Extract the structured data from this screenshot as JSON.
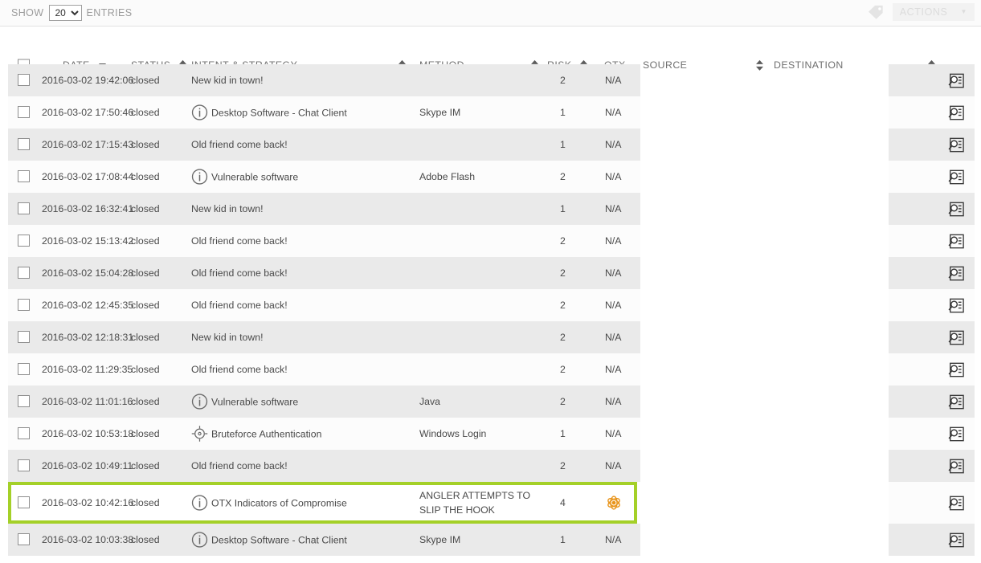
{
  "toolbar": {
    "show_label": "SHOW",
    "entries_label": "ENTRIES",
    "entries_value": "20",
    "entries_options": [
      "20"
    ],
    "tag_icon": "tag-icon",
    "actions_label": "ACTIONS",
    "actions_caret": "▼",
    "actions_disabled": true
  },
  "table": {
    "columns": [
      {
        "label": "DATE",
        "sort": "desc"
      },
      {
        "label": "STATUS",
        "sort": "none"
      },
      {
        "label": "INTENT & STRATEGY",
        "sort": "none"
      },
      {
        "label": "METHOD",
        "sort": "none"
      },
      {
        "label": "RISK",
        "sort": "none"
      },
      {
        "label": "OTX",
        "sort": "hidden"
      },
      {
        "label": "SOURCE",
        "sort": "none"
      },
      {
        "label": "DESTINATION",
        "sort": "none"
      }
    ],
    "rows": [
      {
        "date": "2016-03-02 19:42:06",
        "status": "closed",
        "intent": "New kid in town!",
        "intent_icon": "",
        "method": "",
        "risk": "2",
        "otx": "N/A",
        "highlight": false
      },
      {
        "date": "2016-03-02 17:50:46",
        "status": "closed",
        "intent": "Desktop Software - Chat Client",
        "intent_icon": "info-icon",
        "method": "Skype IM",
        "risk": "1",
        "otx": "N/A",
        "highlight": false
      },
      {
        "date": "2016-03-02 17:15:43",
        "status": "closed",
        "intent": "Old friend come back!",
        "intent_icon": "",
        "method": "",
        "risk": "1",
        "otx": "N/A",
        "highlight": false
      },
      {
        "date": "2016-03-02 17:08:44",
        "status": "closed",
        "intent": "Vulnerable software",
        "intent_icon": "info-icon",
        "method": "Adobe Flash",
        "risk": "2",
        "otx": "N/A",
        "highlight": false
      },
      {
        "date": "2016-03-02 16:32:41",
        "status": "closed",
        "intent": "New kid in town!",
        "intent_icon": "",
        "method": "",
        "risk": "1",
        "otx": "N/A",
        "highlight": false
      },
      {
        "date": "2016-03-02 15:13:42",
        "status": "closed",
        "intent": "Old friend come back!",
        "intent_icon": "",
        "method": "",
        "risk": "2",
        "otx": "N/A",
        "highlight": false
      },
      {
        "date": "2016-03-02 15:04:28",
        "status": "closed",
        "intent": "Old friend come back!",
        "intent_icon": "",
        "method": "",
        "risk": "2",
        "otx": "N/A",
        "highlight": false
      },
      {
        "date": "2016-03-02 12:45:35",
        "status": "closed",
        "intent": "Old friend come back!",
        "intent_icon": "",
        "method": "",
        "risk": "2",
        "otx": "N/A",
        "highlight": false
      },
      {
        "date": "2016-03-02 12:18:31",
        "status": "closed",
        "intent": "New kid in town!",
        "intent_icon": "",
        "method": "",
        "risk": "2",
        "otx": "N/A",
        "highlight": false
      },
      {
        "date": "2016-03-02 11:29:35",
        "status": "closed",
        "intent": "Old friend come back!",
        "intent_icon": "",
        "method": "",
        "risk": "2",
        "otx": "N/A",
        "highlight": false
      },
      {
        "date": "2016-03-02 11:01:16",
        "status": "closed",
        "intent": "Vulnerable software",
        "intent_icon": "info-icon",
        "method": "Java",
        "risk": "2",
        "otx": "N/A",
        "highlight": false
      },
      {
        "date": "2016-03-02 10:53:18",
        "status": "closed",
        "intent": "Bruteforce Authentication",
        "intent_icon": "target-icon",
        "method": "Windows Login",
        "risk": "1",
        "otx": "N/A",
        "highlight": false
      },
      {
        "date": "2016-03-02 10:49:11",
        "status": "closed",
        "intent": "Old friend come back!",
        "intent_icon": "",
        "method": "",
        "risk": "2",
        "otx": "N/A",
        "highlight": false
      },
      {
        "date": "2016-03-02 10:42:16",
        "status": "closed",
        "intent": "OTX Indicators of Compromise",
        "intent_icon": "info-icon",
        "method": "ANGLER ATTEMPTS TO SLIP THE HOOK",
        "risk": "4",
        "otx": "otx-logo",
        "highlight": true
      },
      {
        "date": "2016-03-02 10:03:38",
        "status": "closed",
        "intent": "Desktop Software - Chat Client",
        "intent_icon": "info-icon",
        "method": "Skype IM",
        "risk": "1",
        "otx": "N/A",
        "highlight": false
      }
    ],
    "row_action_icon": "inspect-icon"
  },
  "colors": {
    "highlight_border": "#a4d028",
    "otx_orange": "#e8941a",
    "row_odd": "#eaeaea",
    "row_even": "#fcfcfc"
  }
}
